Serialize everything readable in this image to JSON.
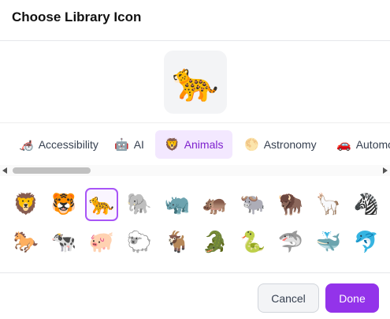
{
  "dialog": {
    "title": "Choose Library Icon",
    "preview_icon": "🐆"
  },
  "tabs": [
    {
      "label": "Accessibility",
      "icon": "🦽",
      "active": false
    },
    {
      "label": "AI",
      "icon": "🤖",
      "active": false
    },
    {
      "label": "Animals",
      "icon": "🦁",
      "active": true
    },
    {
      "label": "Astronomy",
      "icon": "🌕",
      "active": false
    },
    {
      "label": "Automo",
      "icon": "🚗",
      "active": false
    }
  ],
  "icons": {
    "row1": [
      "🦁",
      "🐯",
      "🐆",
      "🐘",
      "🦏",
      "🦛",
      "🐃",
      "🦬",
      "🦙",
      "🦓"
    ],
    "row2": [
      "🐎",
      "🐄",
      "🐖",
      "🐑",
      "🐐",
      "🐊",
      "🐍",
      "🦈",
      "🐳",
      "🐬"
    ],
    "selected": "🐆"
  },
  "footer": {
    "cancel_label": "Cancel",
    "done_label": "Done"
  },
  "colors": {
    "accent": "#9333ea",
    "active_tab_bg": "#f3e8ff",
    "selected_border": "#a855f7"
  }
}
